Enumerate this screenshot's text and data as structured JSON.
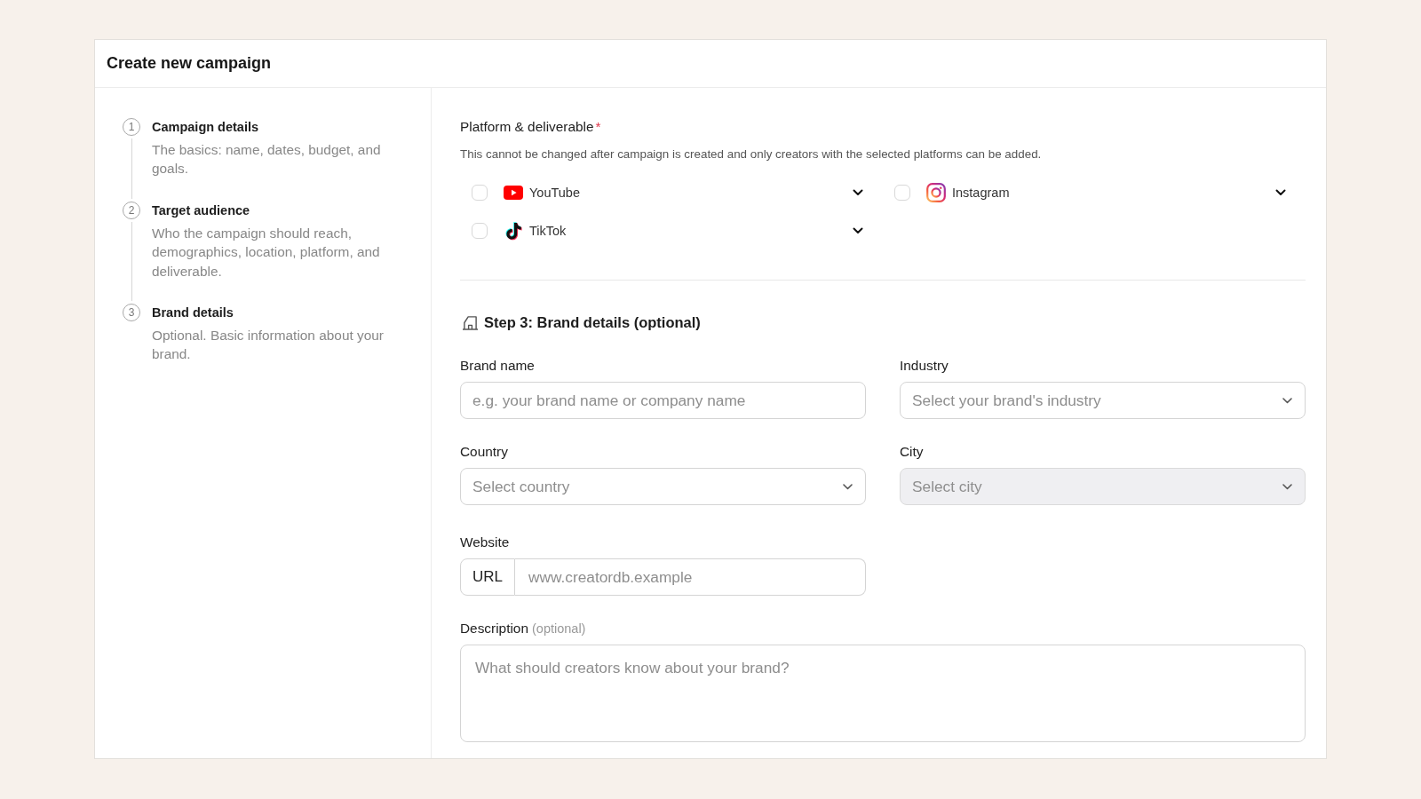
{
  "window": {
    "title": "Create new campaign"
  },
  "steps": [
    {
      "number": "1",
      "title": "Campaign details",
      "description": "The basics: name, dates, budget, and goals."
    },
    {
      "number": "2",
      "title": "Target audience",
      "description": "Who the campaign should reach, demographics, location, platform, and deliverable."
    },
    {
      "number": "3",
      "title": "Brand details",
      "description": "Optional. Basic information about your brand."
    }
  ],
  "platform_section": {
    "label": "Platform & deliverable",
    "required_mark": "*",
    "helper": "This cannot be changed after campaign is created and only creators with the selected platforms can be added.",
    "platforms": [
      {
        "name": "YouTube",
        "kind": "play",
        "checked": false
      },
      {
        "name": "Instagram",
        "kind": "camera",
        "checked": false
      },
      {
        "name": "TikTok",
        "kind": "note",
        "checked": false
      }
    ]
  },
  "brand_section": {
    "heading": "Step 3: Brand details (optional)",
    "fields": [
      {
        "kind": "text",
        "label": "Brand name",
        "placeholder": "e.g. your brand name or company name",
        "disabled": false
      },
      {
        "kind": "select",
        "label": "Industry",
        "placeholder": "Select your brand's industry",
        "disabled": false
      },
      {
        "kind": "select",
        "label": "Country",
        "placeholder": "Select country",
        "disabled": false
      },
      {
        "kind": "select",
        "label": "City",
        "placeholder": "Select city",
        "disabled": true
      },
      {
        "kind": "url",
        "label": "Website",
        "prefix": "URL",
        "placeholder": "www.creatordb.example",
        "disabled": false
      },
      {
        "kind": "textarea",
        "label": "Description",
        "hint": "(optional)",
        "placeholder": "What should creators know about your brand?",
        "disabled": false
      }
    ]
  }
}
